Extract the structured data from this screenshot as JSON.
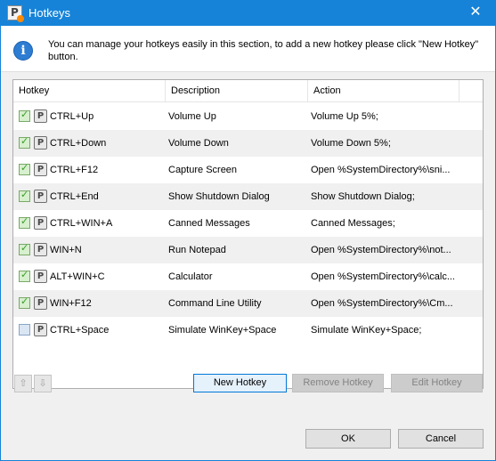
{
  "window": {
    "title": "Hotkeys",
    "close_glyph": "✕"
  },
  "app_icon_letter": "P",
  "info": {
    "icon_glyph": "i",
    "text": "You can manage your hotkeys easily in this section, to add a new hotkey please click \"New Hotkey\" button."
  },
  "table": {
    "columns": [
      "Hotkey",
      "Description",
      "Action"
    ],
    "rows": [
      {
        "enabled": true,
        "hotkey": "CTRL+Up",
        "description": "Volume Up",
        "action": "Volume Up 5%;"
      },
      {
        "enabled": true,
        "hotkey": "CTRL+Down",
        "description": "Volume Down",
        "action": "Volume Down 5%;"
      },
      {
        "enabled": true,
        "hotkey": "CTRL+F12",
        "description": "Capture Screen",
        "action": "Open %SystemDirectory%\\sni..."
      },
      {
        "enabled": true,
        "hotkey": "CTRL+End",
        "description": "Show Shutdown Dialog",
        "action": "Show Shutdown Dialog;"
      },
      {
        "enabled": true,
        "hotkey": "CTRL+WIN+A",
        "description": "Canned Messages",
        "action": "Canned Messages;"
      },
      {
        "enabled": true,
        "hotkey": "WIN+N",
        "description": "Run Notepad",
        "action": "Open %SystemDirectory%\\not..."
      },
      {
        "enabled": true,
        "hotkey": "ALT+WIN+C",
        "description": "Calculator",
        "action": "Open %SystemDirectory%\\calc..."
      },
      {
        "enabled": true,
        "hotkey": "WIN+F12",
        "description": "Command Line Utility",
        "action": "Open %SystemDirectory%\\Cm..."
      },
      {
        "enabled": false,
        "hotkey": "CTRL+Space",
        "description": "Simulate WinKey+Space",
        "action": "Simulate WinKey+Space;"
      }
    ],
    "check_glyph": "✓",
    "badge_letter": "P"
  },
  "move": {
    "up_glyph": "⇧",
    "down_glyph": "⇩"
  },
  "buttons": {
    "new_hotkey": "New Hotkey",
    "remove_hotkey": "Remove Hotkey",
    "edit_hotkey": "Edit Hotkey",
    "ok": "OK",
    "cancel": "Cancel"
  },
  "colors": {
    "titlebar": "#1683d8",
    "primary_border": "#0078d7",
    "check_green": "#3a9b2c"
  }
}
